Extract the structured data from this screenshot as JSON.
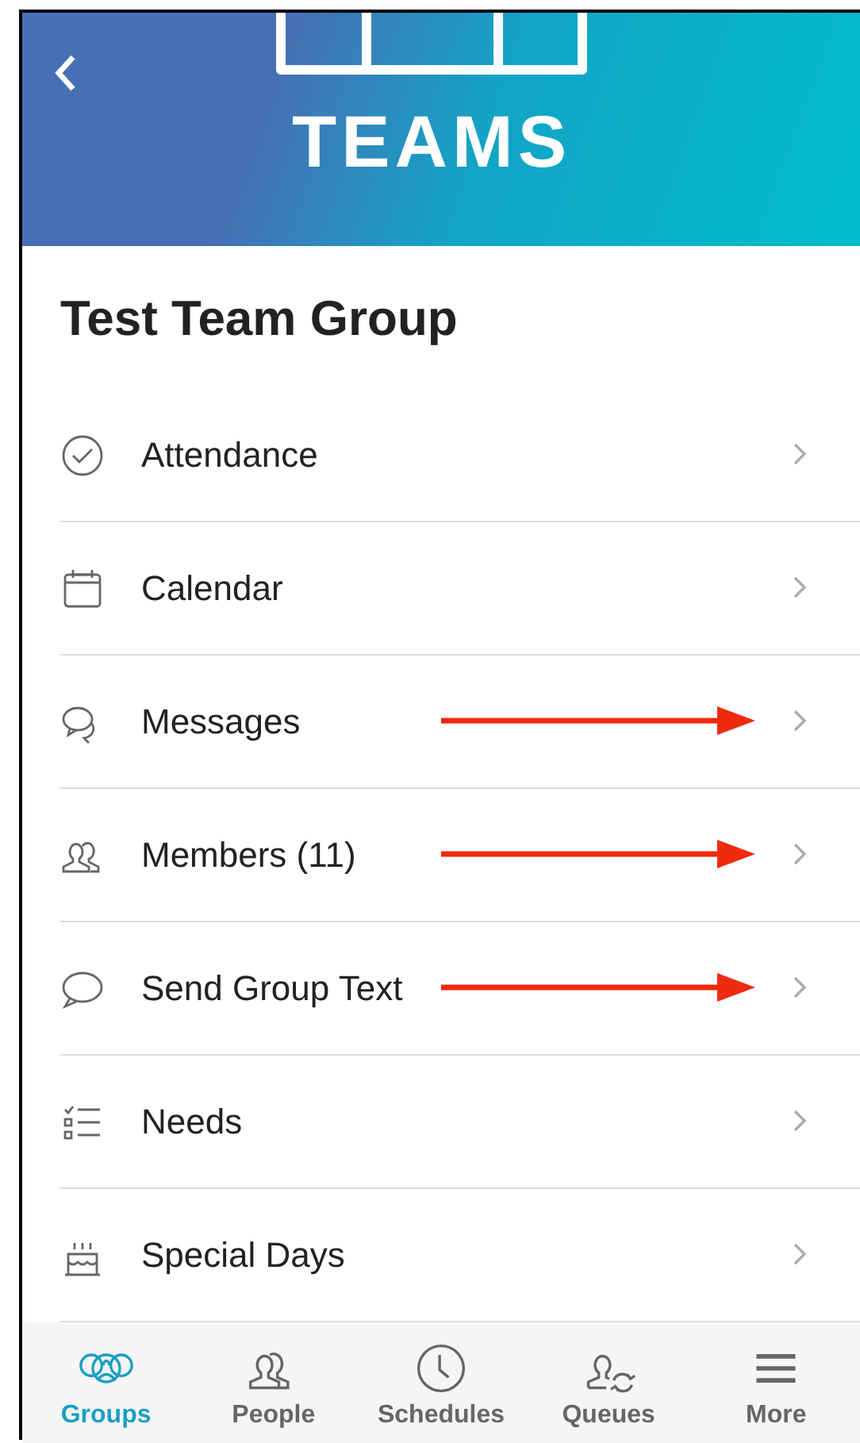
{
  "header": {
    "logo_text": "TEAMS"
  },
  "title": "Test Team Group",
  "items": [
    {
      "label": "Attendance",
      "pointed": false
    },
    {
      "label": "Calendar",
      "pointed": false
    },
    {
      "label": "Messages",
      "pointed": true
    },
    {
      "label": "Members (11)",
      "pointed": true
    },
    {
      "label": "Send Group Text",
      "pointed": true
    },
    {
      "label": "Needs",
      "pointed": false
    },
    {
      "label": "Special Days",
      "pointed": false
    }
  ],
  "nav": [
    {
      "label": "Groups",
      "selected": true
    },
    {
      "label": "People",
      "selected": false
    },
    {
      "label": "Schedules",
      "selected": false
    },
    {
      "label": "Queues",
      "selected": false
    },
    {
      "label": "More",
      "selected": false
    }
  ]
}
